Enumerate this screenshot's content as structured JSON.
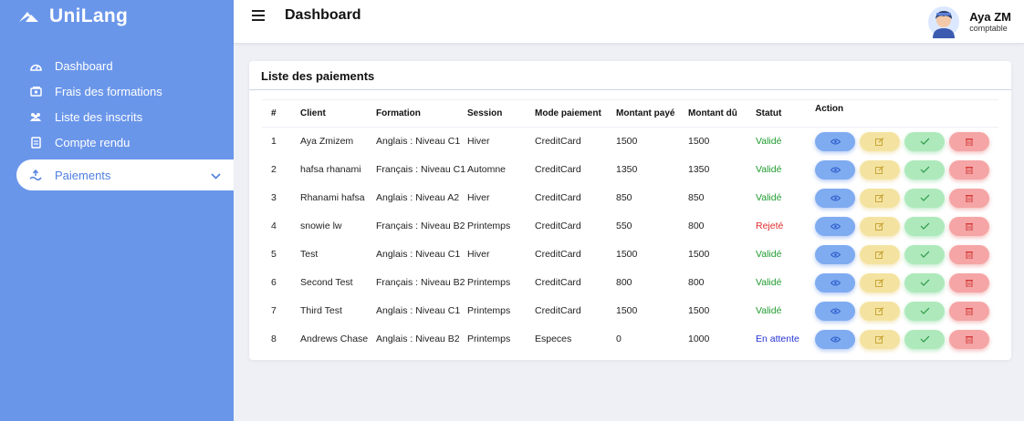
{
  "app": {
    "name": "UniLang"
  },
  "sidebar": {
    "items": [
      {
        "label": "Dashboard",
        "icon": "dashboard-icon"
      },
      {
        "label": "Frais des formations",
        "icon": "money-icon"
      },
      {
        "label": "Liste des inscrits",
        "icon": "users-icon"
      },
      {
        "label": "Compte rendu",
        "icon": "document-icon"
      }
    ],
    "active": {
      "label": "Paiements",
      "icon": "payment-icon"
    }
  },
  "header": {
    "title": "Dashboard",
    "user": {
      "name": "Aya ZM",
      "role": "comptable"
    }
  },
  "payments": {
    "title": "Liste des paiements",
    "columns": [
      "#",
      "Client",
      "Formation",
      "Session",
      "Mode paiement",
      "Montant payé",
      "Montant dû",
      "Statut",
      "Action"
    ],
    "rows": [
      {
        "num": "1",
        "client": "Aya Zmizem",
        "formation": "Anglais : Niveau C1",
        "session": "Hiver",
        "mode": "CreditCard",
        "paye": "1500",
        "du": "1500",
        "statut": "Validé"
      },
      {
        "num": "2",
        "client": "hafsa rhanami",
        "formation": "Français : Niveau C1",
        "session": "Automne",
        "mode": "CreditCard",
        "paye": "1350",
        "du": "1350",
        "statut": "Validé"
      },
      {
        "num": "3",
        "client": "Rhanami hafsa",
        "formation": "Anglais : Niveau A2",
        "session": "Hiver",
        "mode": "CreditCard",
        "paye": "850",
        "du": "850",
        "statut": "Validé"
      },
      {
        "num": "4",
        "client": "snowie lw",
        "formation": "Français : Niveau B2",
        "session": "Printemps",
        "mode": "CreditCard",
        "paye": "550",
        "du": "800",
        "statut": "Rejeté"
      },
      {
        "num": "5",
        "client": "Test",
        "formation": "Anglais : Niveau C1",
        "session": "Hiver",
        "mode": "CreditCard",
        "paye": "1500",
        "du": "1500",
        "statut": "Validé"
      },
      {
        "num": "6",
        "client": "Second Test",
        "formation": "Français : Niveau B2",
        "session": "Printemps",
        "mode": "CreditCard",
        "paye": "800",
        "du": "800",
        "statut": "Validé"
      },
      {
        "num": "7",
        "client": "Third Test",
        "formation": "Anglais : Niveau C1",
        "session": "Printemps",
        "mode": "CreditCard",
        "paye": "1500",
        "du": "1500",
        "statut": "Validé"
      },
      {
        "num": "8",
        "client": "Andrews Chase",
        "formation": "Anglais : Niveau B2",
        "session": "Printemps",
        "mode": "Especes",
        "paye": "0",
        "du": "1000",
        "statut": "En attente"
      }
    ]
  },
  "colors": {
    "sidebar": "#6a96ea",
    "valide": "#1e9a2e",
    "rejete": "#e02a2a",
    "attente": "#2433d6",
    "view": "#7fabf0",
    "edit": "#f4e3a0",
    "approve": "#aee9bb",
    "delete": "#f5a5a5"
  }
}
